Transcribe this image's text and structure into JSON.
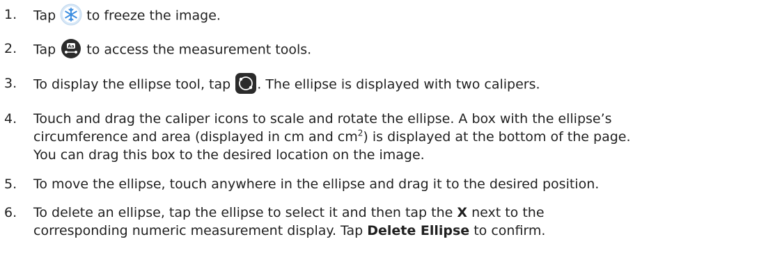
{
  "steps": [
    {
      "number": "1.",
      "before": "Tap ",
      "icon": "snowflake-freeze-icon",
      "after": " to freeze the image."
    },
    {
      "number": "2.",
      "before": "Tap ",
      "icon": "measurement-tools-icon",
      "icon_text": "Aa",
      "after": " to access the measurement tools."
    },
    {
      "number": "3.",
      "before": "To display the ellipse tool, tap ",
      "icon": "ellipse-tool-icon",
      "after": ". The ellipse is displayed with two calipers."
    },
    {
      "number": "4.",
      "line1": "Touch and drag the caliper icons to scale and rotate the ellipse. A box with the ellipse’s",
      "line2_a": "circumference and area (displayed in cm and cm",
      "line2_sup": "2",
      "line2_b": ") is displayed at the bottom of the page.",
      "line3": "You can drag this box to the desired location on the image."
    },
    {
      "number": "5.",
      "text": "To move the ellipse, touch anywhere in the ellipse and drag it to the desired position."
    },
    {
      "number": "6.",
      "line1_a": "To delete an ellipse, tap the ellipse to select it and then tap the ",
      "line1_bold": "X",
      "line1_b": " next to the",
      "line2_a": "corresponding numeric measurement display. Tap ",
      "line2_bold": "Delete Ellipse",
      "line2_b": " to confirm."
    }
  ],
  "colors": {
    "text": "#1f1f1f",
    "snowflake_bg": "#ffffff",
    "snowflake_ring": "#d6e7f7",
    "snowflake": "#3d8ee0",
    "dark_icon_bg": "#2b2b2b",
    "dark_icon_fg": "#ffffff"
  }
}
